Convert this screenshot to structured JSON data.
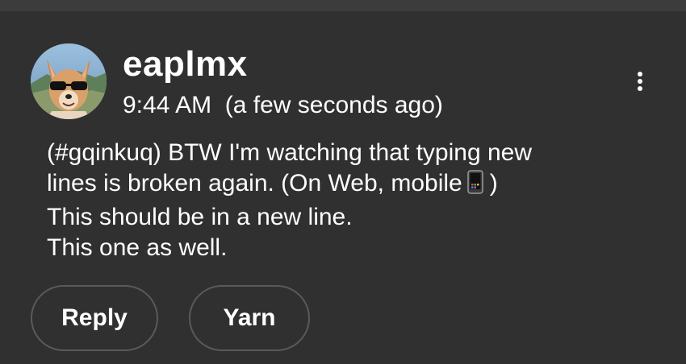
{
  "post": {
    "username": "eaplmx",
    "time": "9:44 AM",
    "relative_time": "(a few seconds ago)",
    "message_lines": [
      "(#gqinkuq) BTW I'm watching that typing new",
      "lines is broken again. (On Web, mobile",
      ")",
      "This should be in a new line.",
      "This one as well."
    ],
    "emoji": "mobile-phone-icon"
  },
  "actions": {
    "reply_label": "Reply",
    "yarn_label": "Yarn"
  },
  "icons": {
    "more": "more-vert-icon",
    "avatar": "dog-with-sunglasses-avatar"
  },
  "colors": {
    "background": "#303030",
    "text": "#ffffff",
    "pill_border": "#5a5a5a"
  }
}
